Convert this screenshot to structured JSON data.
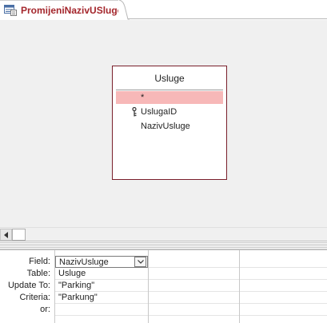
{
  "tab": {
    "title": "PromijeniNazivUSluge",
    "icon": "query-design-icon"
  },
  "table_box": {
    "title": "Usluge",
    "fields": [
      {
        "label": "*"
      },
      {
        "label": "UslugaID",
        "icon": "primary-key-icon"
      },
      {
        "label": "NazivUsluge"
      }
    ]
  },
  "grid": {
    "row_labels": [
      "Field:",
      "Table:",
      "Update To:",
      "Criteria:",
      "or:"
    ],
    "columns": [
      {
        "field": "NazivUsluge",
        "table": "Usluge",
        "update_to": "\"Parking\"",
        "criteria": "\"Parkung\"",
        "or": ""
      },
      {
        "field": "",
        "table": "",
        "update_to": "",
        "criteria": "",
        "or": ""
      },
      {
        "field": "",
        "table": "",
        "update_to": "",
        "criteria": "",
        "or": ""
      }
    ]
  },
  "colors": {
    "tab_title": "#a4262c",
    "selected_field": "#f7b8b8",
    "table_border": "#7a1f2b",
    "design_bg": "#f0f0f0"
  }
}
